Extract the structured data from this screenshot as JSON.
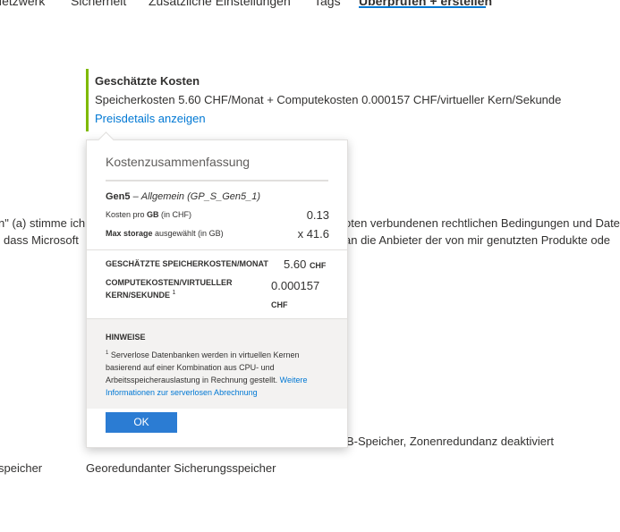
{
  "tabs": [
    "Netzwerk",
    "Sicherheit",
    "Zusätzliche Einstellungen",
    "Tags",
    "Überprüfen + erstellen"
  ],
  "cost": {
    "title": "Geschätzte Kosten",
    "line": "Speicherkosten 5.60 CHF/Monat + Computekosten 0.000157 CHF/virtueller Kern/Sekunde",
    "link": "Preisdetails anzeigen"
  },
  "background": {
    "terms_line1_left": "n\" (a) stimme ich",
    "terms_line1_right": "oten verbundenen rechtlichen Bedingungen und Date",
    "terms_line2_left": "dass Microsoft",
    "terms_line2_right": "an die Anbieter der von mir genutzten Produkte ode",
    "storage_info": "B-Speicher, Zonenredundanz deaktiviert",
    "backup_label": "speicher",
    "backup_value": "Georedundanter Sicherungsspeicher"
  },
  "popup": {
    "header": "Kostenzusammenfassung",
    "gen_bold": "Gen5",
    "gen_rest": " – ",
    "gen_italic": "Allgemein (GP_S_Gen5_1)",
    "cost_per_gb_prefix": "Kosten pro ",
    "cost_per_gb_bold": "GB",
    "cost_per_gb_suffix": " (in CHF)",
    "cost_per_gb_value": "0.13",
    "max_storage_bold": "Max storage",
    "max_storage_suffix": " ausgewählt (in GB)",
    "max_storage_value": "x 41.6",
    "storage_costs_label": "GESCHÄTZTE SPEICHERKOSTEN/MONAT",
    "storage_costs_value": "5.60",
    "storage_costs_unit": "CHF",
    "compute_label_line1": "COMPUTEKOSTEN/VIRTUELLER",
    "compute_label_line2": "KERN/SEKUNDE",
    "compute_sup": "1",
    "compute_value": "0.000157",
    "compute_unit": "CHF",
    "notes_title": "HINWEISE",
    "notes_sup": "1",
    "notes_text": " Serverlose Datenbanken werden in virtuellen Kernen basierend auf einer Kombination aus CPU- und Arbeitsspeicherauslastung in Rechnung gestellt. ",
    "notes_link": "Weitere Informationen zur serverlosen Abrechnung",
    "ok_label": "OK"
  }
}
